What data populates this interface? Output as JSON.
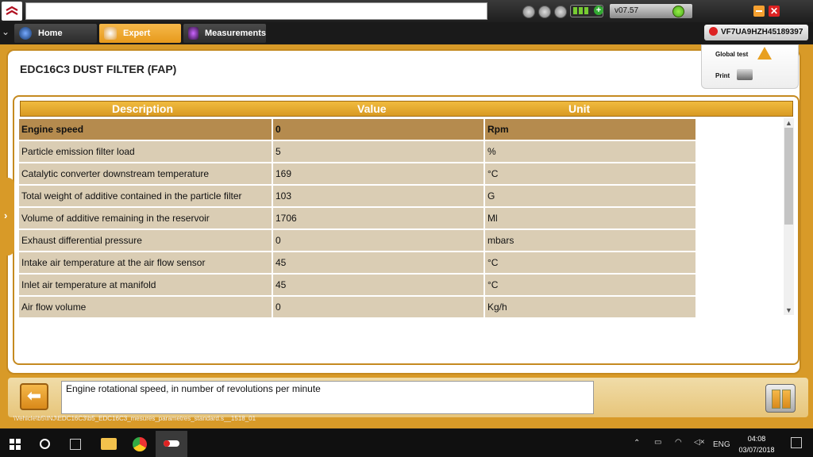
{
  "top": {
    "version": "v07.57",
    "vin": "VF7UA9HZH45189397"
  },
  "tabs": [
    {
      "label": "Home"
    },
    {
      "label": "Expert"
    },
    {
      "label": "Measurements"
    }
  ],
  "page": {
    "title": "EDC16C3  DUST FILTER (FAP)",
    "global_test": "Global test",
    "print": "Print"
  },
  "table": {
    "headers": [
      "Description",
      "Value",
      "Unit"
    ],
    "rows": [
      {
        "description": "Engine speed",
        "value": "0",
        "unit": "Rpm"
      },
      {
        "description": "Particle emission filter load",
        "value": "5",
        "unit": "%"
      },
      {
        "description": "Catalytic converter downstream temperature",
        "value": "169",
        "unit": "°C"
      },
      {
        "description": "Total weight of additive contained in the particle filter",
        "value": "103",
        "unit": "G"
      },
      {
        "description": "Volume of additive remaining in the reservoir",
        "value": "1706",
        "unit": "Ml"
      },
      {
        "description": "Exhaust differential pressure",
        "value": "0",
        "unit": "mbars"
      },
      {
        "description": "Intake air temperature at the air flow sensor",
        "value": "45",
        "unit": "°C"
      },
      {
        "description": "Inlet air temperature at manifold",
        "value": "45",
        "unit": "°C"
      },
      {
        "description": "Air flow volume",
        "value": "0",
        "unit": "Kg/h"
      }
    ]
  },
  "help_text": "Engine rotational speed, in number of revolutions per minute",
  "path": "\\Vehicle\\b5\\INJ\\EDC16C3\\b5_EDC16C3_mesures_parametres_standard.s__1518_01",
  "taskbar": {
    "lang": "ENG",
    "time": "04:08",
    "date": "03/07/2018"
  },
  "colors": {
    "accent": "#d89a28",
    "row": "#dacdb4",
    "selected_row": "#b58b4e"
  }
}
